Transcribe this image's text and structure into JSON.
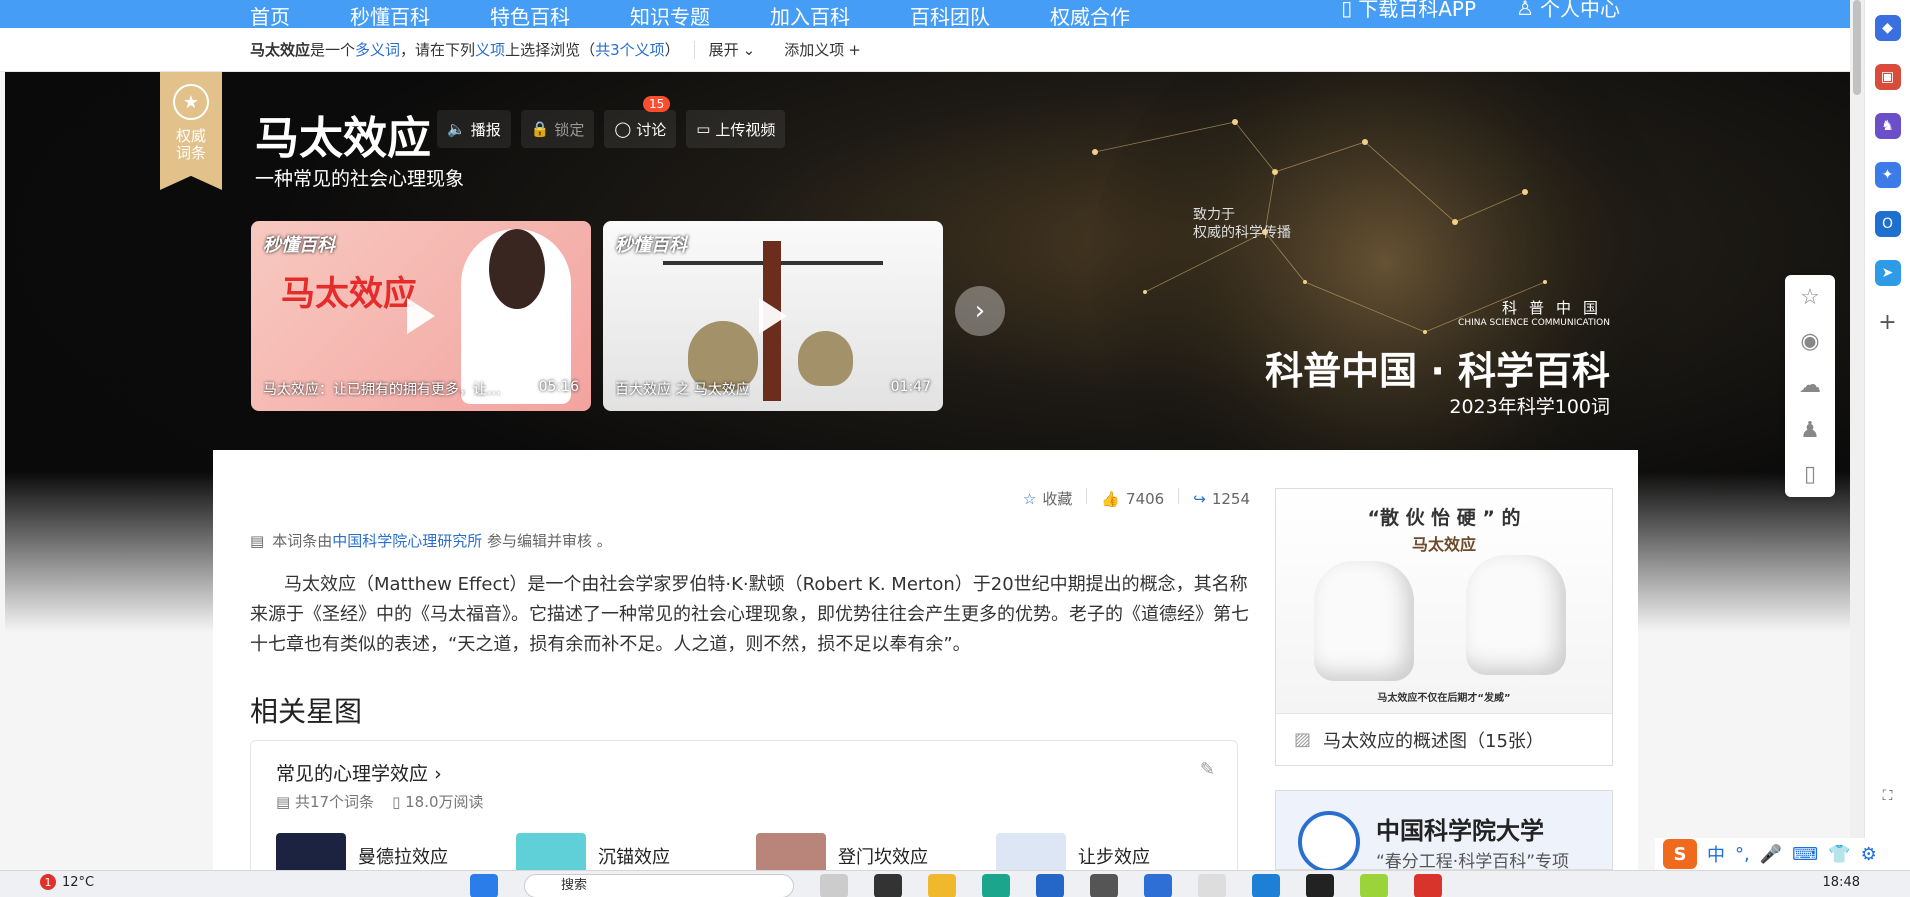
{
  "nav": {
    "items": [
      "首页",
      "秒懂百科",
      "特色百科",
      "知识专题",
      "加入百科",
      "百科团队",
      "权威合作"
    ],
    "app": "下载百科APP",
    "user": "个人中心"
  },
  "disambig": {
    "term": "马太效应",
    "text1": "是一个",
    "polysemy": "多义词",
    "text2": "，请在下列",
    "sense": "义项",
    "text3": "上选择浏览（",
    "count": "共3个义项",
    "text4": "）",
    "expand": "展开",
    "add": "添加义项"
  },
  "ribbon": {
    "line1": "权威",
    "line2": "词条"
  },
  "hero": {
    "title": "马太效应",
    "subtitle": "一种常见的社会心理现象",
    "actions": {
      "broadcast": "播报",
      "lock": "锁定",
      "discuss": "讨论",
      "discuss_badge": "15",
      "upload": "上传视频"
    },
    "videos": [
      {
        "logo": "秒懂百科",
        "big": "马太效应",
        "title": "马太效应：让已拥有的拥有更多，让…",
        "duration": "05:16"
      },
      {
        "logo": "秒懂百科",
        "title": "百大效应 之 马太效应",
        "duration": "01:47"
      }
    ],
    "slogan1": "致力于",
    "slogan2": "权威的科学传播",
    "brand_cn": "科普中国",
    "brand_en": "CHINA SCIENCE COMMUNICATION",
    "brand_title": "科普中国 · 科学百科",
    "brand_sub": "2023年科学100词"
  },
  "stats": {
    "fav": "收藏",
    "likes": "7406",
    "shares": "1254"
  },
  "credit": {
    "prefix": "本词条由",
    "org": "中国科学院心理研究所",
    "suffix": "参与编辑并审核 。"
  },
  "summary": "马太效应（Matthew Effect）是一个由社会学家罗伯特·K·默顿（Robert K. Merton）于20世纪中期提出的概念，其名称来源于《圣经》中的《马太福音》。它描述了一种常见的社会心理现象，即优势往往会产生更多的优势。老子的《道德经》第七十七章也有类似的表述，“天之道，损有余而补不足。人之道，则不然，损不足以奉有余”。",
  "section": "相关星图",
  "starmap": {
    "title": "常见的心理学效应",
    "count": "共17个词条",
    "reads": "18.0万阅读",
    "items": [
      "曼德拉效应",
      "沉锚效应",
      "登门坎效应",
      "让步效应"
    ]
  },
  "sidepic": {
    "cap1": "“散 伙 怡 硬 ” 的",
    "cap1b": "马太效应",
    "cap2": "马太效应不仅在后期才“发威”",
    "footer": "马太效应的概述图（15张）"
  },
  "ucas": {
    "name": "中国科学院大学",
    "sub": "“春分工程·科学百科”专项"
  },
  "taskbar": {
    "weather_badge": "1",
    "temp": "12°C",
    "search": "搜索",
    "time": "18:48"
  },
  "ime": {
    "lang": "中"
  }
}
